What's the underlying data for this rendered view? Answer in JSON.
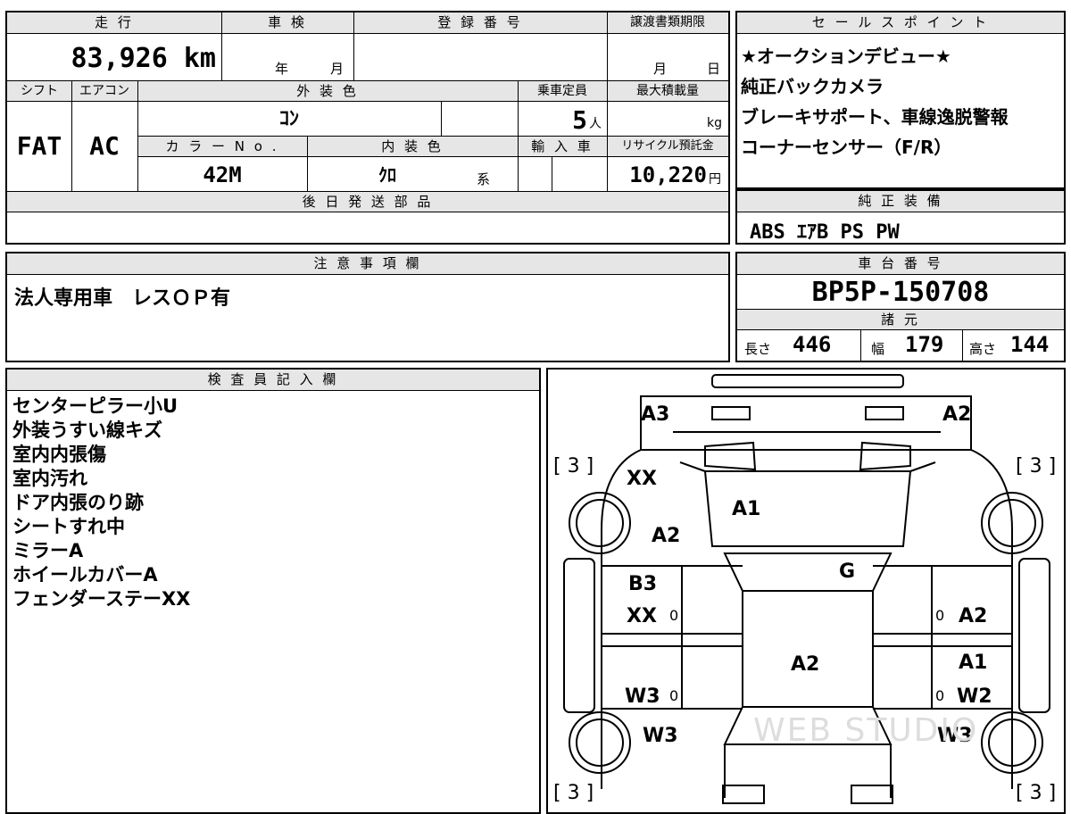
{
  "top": {
    "labels": {
      "mileage": "走 行",
      "inspection": "車 検",
      "registration": "登 録 番 号",
      "transfer_deadline": "譲渡書類期限",
      "shift": "シフト",
      "aircon": "エアコン",
      "exterior_color": "外 装 色",
      "capacity": "乗車定員",
      "max_load": "最大積載量",
      "color_no": "カ ラ ー N o .",
      "interior_color": "内 装 色",
      "import": "輸 入 車",
      "recycle": "リサイクル預託金",
      "later_parts": "後 日 発 送 部 品"
    },
    "values": {
      "mileage": "83,926 km",
      "year_unit": "年",
      "month_unit": "月",
      "deadline_month": "月",
      "deadline_day": "日",
      "shift": "FAT",
      "aircon": "AC",
      "exterior_color": "ｺﾝ",
      "capacity": "5",
      "capacity_unit": "人",
      "max_load_unit": "kg",
      "color_no": "42M",
      "interior_color": "ｸﾛ",
      "interior_suffix": "系",
      "recycle": "10,220",
      "recycle_unit": "円"
    }
  },
  "sales_point": {
    "header": "セ ー ル ス ポ イ ン ト",
    "lines": [
      "★オークションデビュー★",
      "純正バックカメラ",
      "ブレーキサポート、車線逸脱警報",
      "コーナーセンサー（F/R）"
    ]
  },
  "equipment": {
    "header": "純 正 装 備",
    "value": "ABS ｴｱB PS PW"
  },
  "notes": {
    "header": "注 意 事 項 欄",
    "value": "法人専用車　レスＯＰ有"
  },
  "chassis": {
    "header": "車 台 番 号",
    "value": "BP5P-150708",
    "specs_header": "諸 元",
    "length_label": "長さ",
    "length": "446",
    "width_label": "幅",
    "width": "179",
    "height_label": "高さ",
    "height": "144"
  },
  "inspector": {
    "header": "検 査 員 記 入 欄",
    "lines": [
      "センターピラー小U",
      "外装うすい線キズ",
      "室内内張傷",
      "室内汚れ",
      "ドア内張のり跡",
      "シートすれ中",
      "ミラーA",
      "ホイールカバーA",
      "フェンダーステーXX"
    ]
  },
  "diagram": {
    "labels": {
      "front_left": "A3",
      "front_right": "A2",
      "tire_fl": "[ 3 ]",
      "tire_fr": "[ 3 ]",
      "tire_rl": "[ 3 ]",
      "tire_rr": "[ 3 ]",
      "fender_left_top": "XX",
      "fender_left": "A2",
      "hood": "A1",
      "glass": "G",
      "door_fl_1": "B3",
      "door_fl_2": "XX",
      "door_fr": "A2",
      "roof": "A2",
      "door_rl": "W3",
      "door_rr_1": "A1",
      "door_rr_2": "W2",
      "rear_left": "W3",
      "rear_right": "W3",
      "zero_1": "0",
      "zero_2": "0",
      "zero_3": "0",
      "zero_4": "0"
    },
    "watermark": "WEB STUDIO"
  }
}
